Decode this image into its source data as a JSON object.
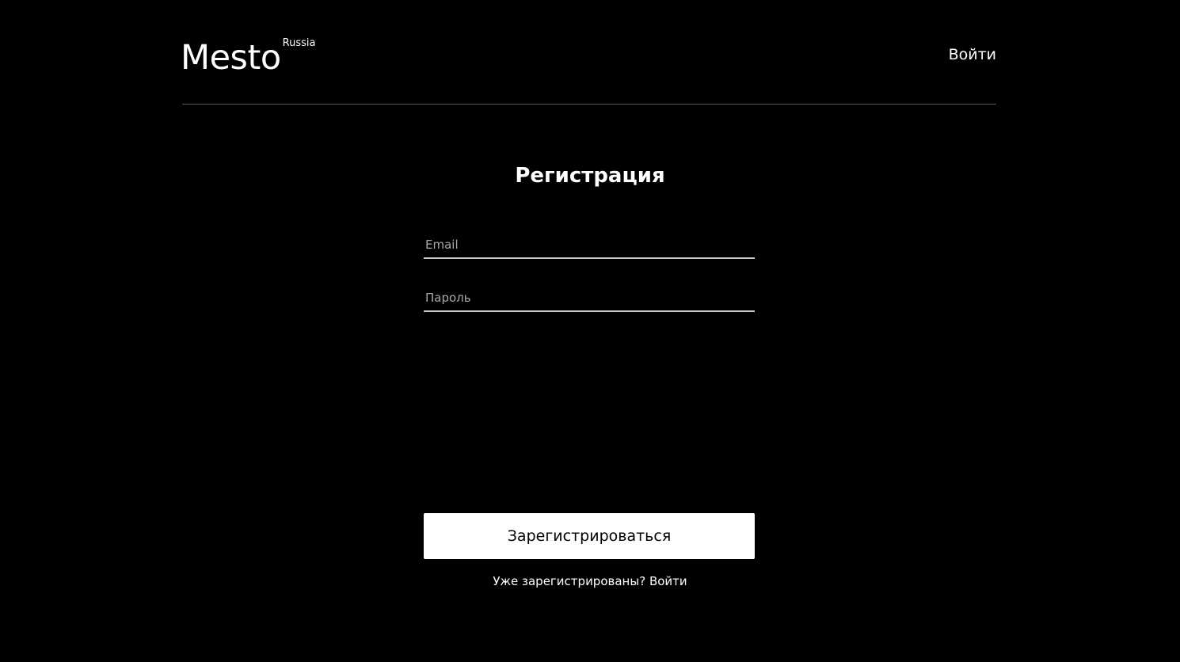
{
  "header": {
    "logo_text": "Mesto",
    "logo_superscript": "Russia",
    "login_link": "Войти"
  },
  "form": {
    "title": "Регистрация",
    "email_placeholder": "Email",
    "password_placeholder": "Пароль",
    "submit_label": "Зарегистрироваться",
    "hint_text": "Уже зарегистрированы?",
    "hint_link": "Войти"
  },
  "colors": {
    "background": "#000000",
    "text": "#ffffff",
    "divider": "#545454",
    "placeholder": "#a8a8a8",
    "button_background": "#ffffff",
    "button_text": "#000000"
  }
}
